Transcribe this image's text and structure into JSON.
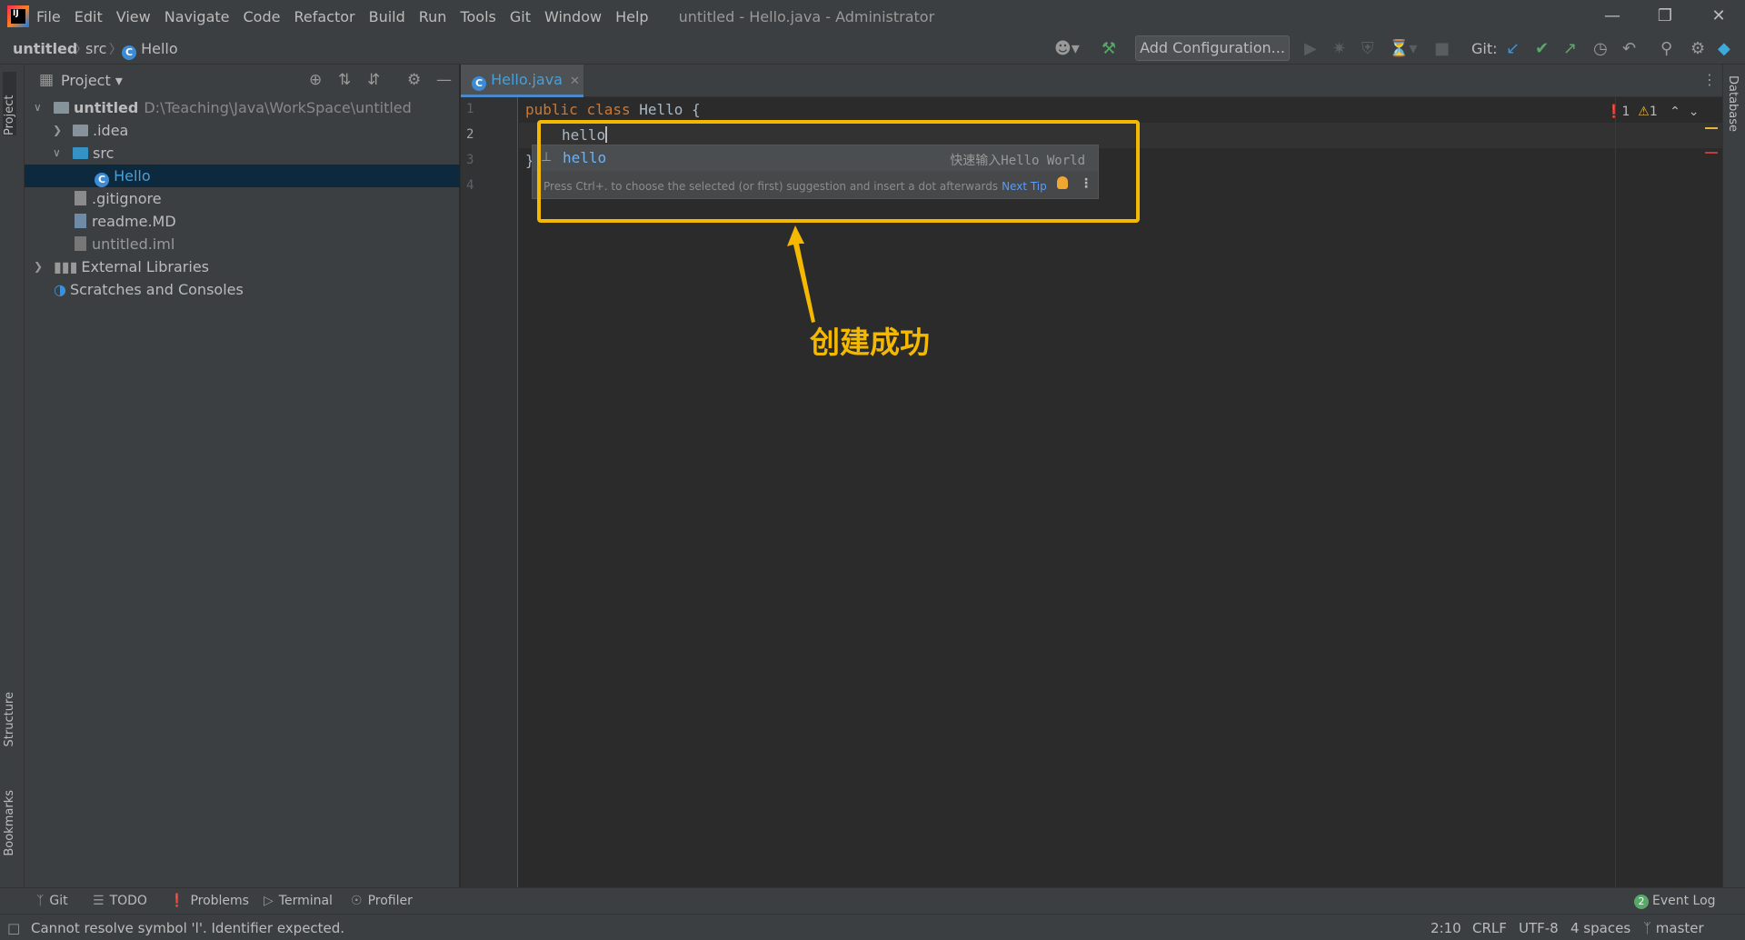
{
  "titlebar": {
    "menus": [
      "File",
      "Edit",
      "View",
      "Navigate",
      "Code",
      "Refactor",
      "Build",
      "Run",
      "Tools",
      "Git",
      "Window",
      "Help"
    ],
    "window_title": "untitled - Hello.java - Administrator"
  },
  "breadcrumb": {
    "project": "untitled",
    "folder": "src",
    "file": "Hello"
  },
  "toolbar": {
    "add_configuration": "Add Configuration...",
    "git_label": "Git:"
  },
  "left_stripe": {
    "project": "Project",
    "structure": "Structure",
    "bookmarks": "Bookmarks"
  },
  "right_stripe": {
    "database": "Database"
  },
  "project_panel": {
    "title": "Project",
    "tree": [
      {
        "label": "untitled",
        "path": "D:\\Teaching\\Java\\WorkSpace\\untitled"
      },
      {
        "label": ".idea"
      },
      {
        "label": "src"
      },
      {
        "label": "Hello"
      },
      {
        "label": ".gitignore"
      },
      {
        "label": "readme.MD"
      },
      {
        "label": "untitled.iml"
      },
      {
        "label": "External Libraries"
      },
      {
        "label": "Scratches and Consoles"
      }
    ]
  },
  "editor": {
    "tab": "Hello.java",
    "line_numbers": [
      "1",
      "2",
      "3",
      "4"
    ],
    "line1_kw1": "public",
    "line1_kw2": "class",
    "line1_name": "Hello {",
    "line2_text": "hello",
    "line3_text": "}",
    "errors": "1",
    "warnings": "1"
  },
  "completion": {
    "item": "hello",
    "description": "快速输入Hello World",
    "hint": "Press Ctrl+. to choose the selected (or first) suggestion and insert a dot afterwards",
    "next_tip": "Next Tip"
  },
  "annotation": {
    "label": "创建成功",
    "color": "#f5b800"
  },
  "bottom_tools": {
    "git": "Git",
    "todo": "TODO",
    "problems": "Problems",
    "terminal": "Terminal",
    "profiler": "Profiler",
    "event_log": "Event Log",
    "event_count": "2"
  },
  "status_bar": {
    "message": "Cannot resolve symbol 'l'. Identifier expected.",
    "position": "2:10",
    "line_sep": "CRLF",
    "encoding": "UTF-8",
    "indent": "4 spaces",
    "branch": "master"
  }
}
